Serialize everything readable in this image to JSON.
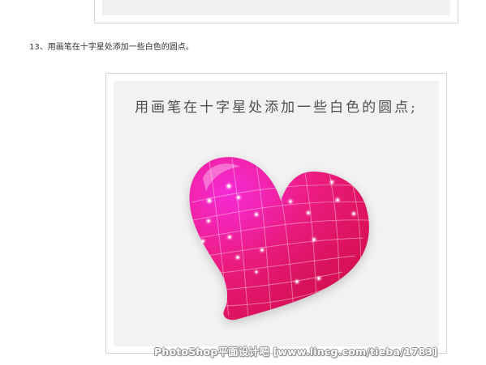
{
  "step": {
    "text": "13、用画笔在十字星处添加一些白色的圆点。"
  },
  "figure": {
    "caption": "用画笔在十字星处添加一些白色的圆点;",
    "heart_colors": {
      "top_left": "#f52ad6",
      "middle": "#ee1d86",
      "bottom": "#d80f4e"
    }
  },
  "watermark": {
    "text": "PhotoShop平面设计吧 [www.lincg.com/tieba/1783]"
  }
}
